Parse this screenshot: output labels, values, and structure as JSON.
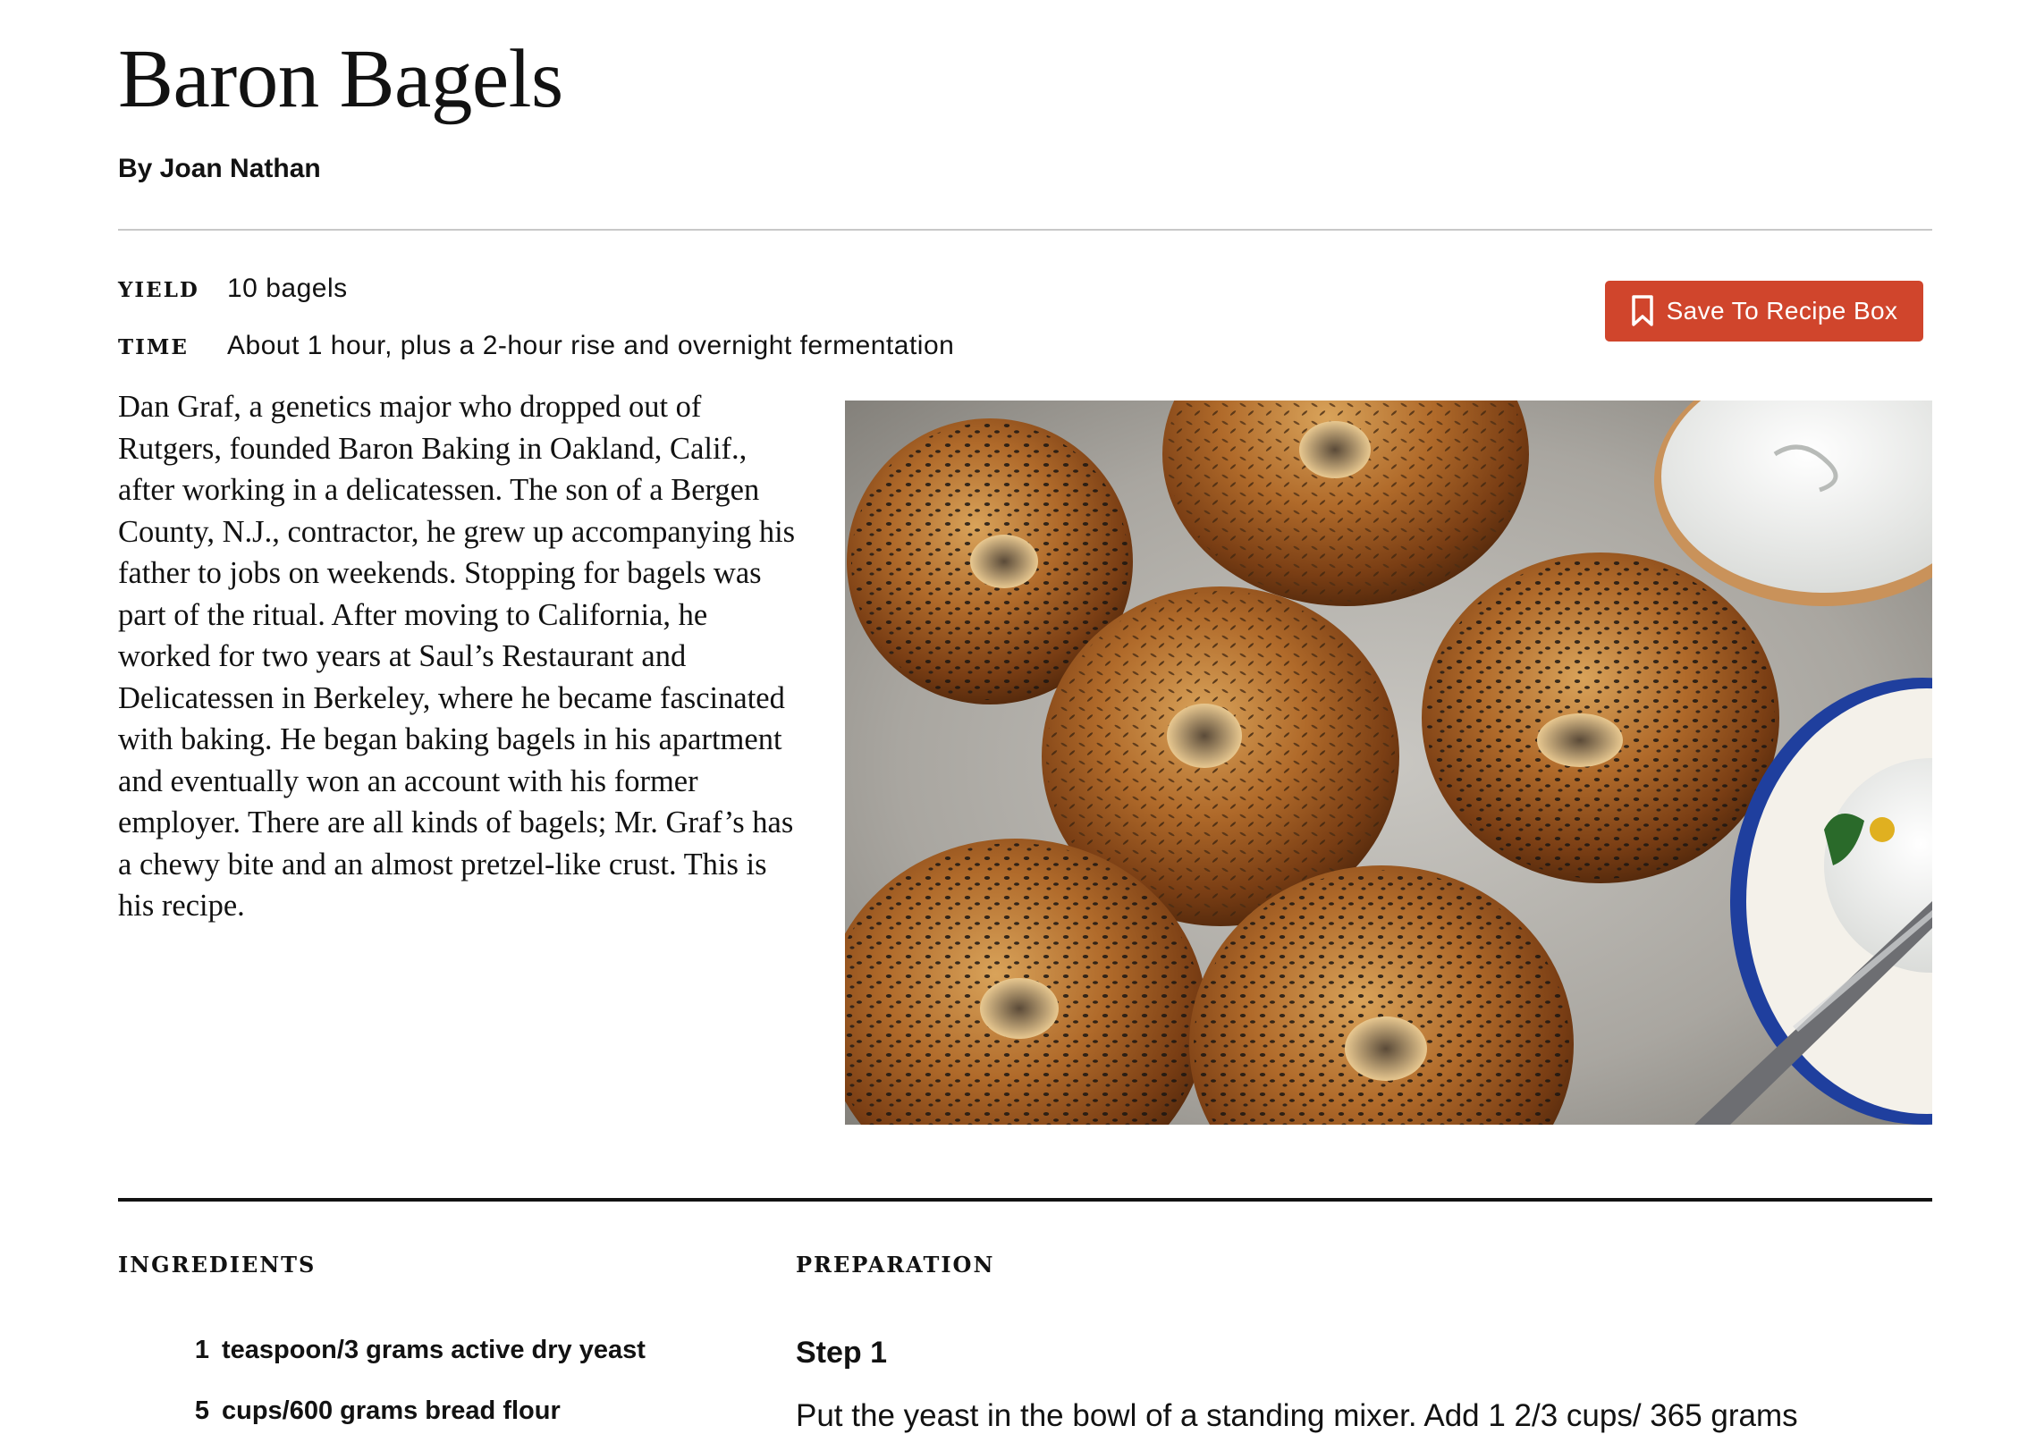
{
  "recipe": {
    "title": "Baron Bagels",
    "byline": "By Joan Nathan",
    "yield_label": "Yield",
    "yield_value": "10 bagels",
    "time_label": "Time",
    "time_value": "About 1 hour, plus a 2-hour rise and overnight fermentation",
    "save_button_label": "Save To Recipe Box",
    "save_icon": "bookmark-icon",
    "intro": "Dan Graf, a genetics major who dropped out of Rutgers, founded Baron Baking in Oakland, Calif., after working in a delicatessen. The son of a Bergen County, N.J., contractor, he grew up accompanying his father to jobs on weekends. Stopping for bagels was part of the ritual. After moving to California, he worked for two years at Saul’s Restaurant and Delicatessen in Berkeley, where he became fascinated with baking. He began baking bagels in his apartment and eventually won an account with his former employer. There are all kinds of bagels; Mr. Graf’s has a chewy bite and an almost pretzel-like crust. This is his recipe."
  },
  "ingredients": {
    "label": "Ingredients",
    "items": [
      {
        "qty": "1",
        "text": "teaspoon/3 grams active dry yeast"
      },
      {
        "qty": "5",
        "text": "cups/600 grams bread flour"
      }
    ]
  },
  "preparation": {
    "label": "Preparation",
    "steps": [
      {
        "title": "Step 1",
        "text": "Put the yeast in the bowl of a standing mixer. Add 1 2/3 cups/ 365 grams"
      }
    ]
  },
  "colors": {
    "accent": "#d0452c",
    "text": "#121212",
    "rule": "#c8c8c8"
  }
}
